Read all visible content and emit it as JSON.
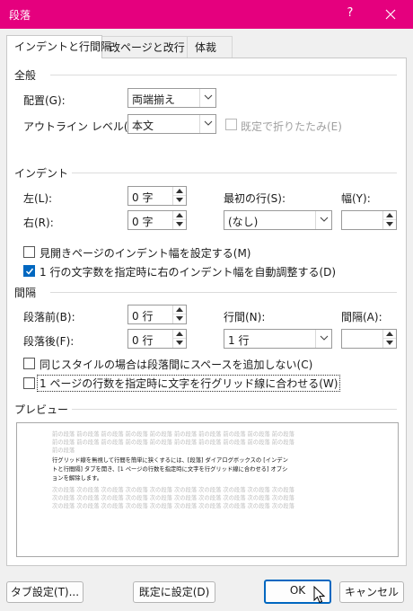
{
  "window": {
    "title": "段落",
    "help": "?"
  },
  "tabs": [
    {
      "label": "インデントと行間隔"
    },
    {
      "label": "改ページと改行"
    },
    {
      "label": "体裁"
    }
  ],
  "general": {
    "label": "全般",
    "alignment": {
      "label": "配置(G):",
      "value": "両端揃え"
    },
    "outline": {
      "label": "アウトライン レベル(O):",
      "value": "本文"
    },
    "collapsed": {
      "label": "既定で折りたたみ(E)"
    }
  },
  "indent": {
    "label": "インデント",
    "left": {
      "label": "左(L):",
      "value": "0 字"
    },
    "right": {
      "label": "右(R):",
      "value": "0 字"
    },
    "first_line": {
      "label": "最初の行(S):",
      "value": "(なし)"
    },
    "width": {
      "label": "幅(Y):",
      "value": ""
    },
    "mirror": {
      "label": "見開きページのインデント幅を設定する(M)"
    },
    "auto_adjust": {
      "label": "1 行の文字数を指定時に右のインデント幅を自動調整する(D)"
    }
  },
  "spacing": {
    "label": "間隔",
    "before": {
      "label": "段落前(B):",
      "value": "0 行"
    },
    "after": {
      "label": "段落後(F):",
      "value": "0 行"
    },
    "line_spacing": {
      "label": "行間(N):",
      "value": "1 行"
    },
    "at": {
      "label": "間隔(A):",
      "value": ""
    },
    "no_space_same_style": {
      "label": "同じスタイルの場合は段落間にスペースを追加しない(C)"
    },
    "snap_grid": {
      "label": "1 ページの行数を指定時に文字を行グリッド線に合わせる(W)"
    }
  },
  "preview": {
    "label": "プレビュー",
    "prev_text": "前の段落 前の段落 前の段落 前の段落 前の段落 前の段落 前の段落 前の段落 前の段落 前の段落",
    "prev_line3": "前の段落",
    "current_lines": [
      "行グリッド線を無視して行間を簡単に狭くするには、[段落] ダイアログボックスの [インデン",
      "トと行間隔] タブを開き、[1 ページの行数を指定時に文字を行グリッド線に合わせる] オプシ",
      "ョンを解除します。"
    ],
    "next_text": "次の段落 次の段落 次の段落 次の段落 次の段落 次の段落 次の段落 次の段落 次の段落 次の段落"
  },
  "buttons": {
    "tabs": "タブ設定(T)...",
    "default": "既定に設定(D)",
    "ok": "OK",
    "cancel": "キャンセル"
  },
  "colors": {
    "titlebar": "#e5007e",
    "accent": "#0067c0"
  }
}
